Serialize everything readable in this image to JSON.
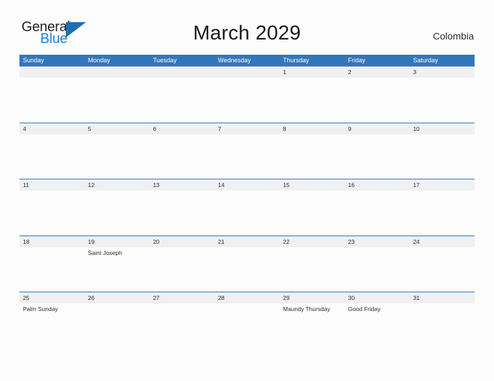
{
  "brand": {
    "name_part1": "General",
    "name_part2": "Blue",
    "flag_icon": "flag-triangle-icon",
    "color_dark": "#231f20",
    "color_blue": "#1b7fd4"
  },
  "header": {
    "title": "March 2029",
    "region": "Colombia"
  },
  "theme": {
    "header_blue": "#3276bc",
    "band_gray": "#f0f0f0",
    "page_background": "#fdfdfd",
    "text": "#2b2b2b"
  },
  "calendar": {
    "weekdays": [
      "Sunday",
      "Monday",
      "Tuesday",
      "Wednesday",
      "Thursday",
      "Friday",
      "Saturday"
    ],
    "weeks": [
      [
        {
          "date": "",
          "events": []
        },
        {
          "date": "",
          "events": []
        },
        {
          "date": "",
          "events": []
        },
        {
          "date": "",
          "events": []
        },
        {
          "date": "1",
          "events": []
        },
        {
          "date": "2",
          "events": []
        },
        {
          "date": "3",
          "events": []
        }
      ],
      [
        {
          "date": "4",
          "events": []
        },
        {
          "date": "5",
          "events": []
        },
        {
          "date": "6",
          "events": []
        },
        {
          "date": "7",
          "events": []
        },
        {
          "date": "8",
          "events": []
        },
        {
          "date": "9",
          "events": []
        },
        {
          "date": "10",
          "events": []
        }
      ],
      [
        {
          "date": "11",
          "events": []
        },
        {
          "date": "12",
          "events": []
        },
        {
          "date": "13",
          "events": []
        },
        {
          "date": "14",
          "events": []
        },
        {
          "date": "15",
          "events": []
        },
        {
          "date": "16",
          "events": []
        },
        {
          "date": "17",
          "events": []
        }
      ],
      [
        {
          "date": "18",
          "events": []
        },
        {
          "date": "19",
          "events": [
            "Saint Joseph"
          ]
        },
        {
          "date": "20",
          "events": []
        },
        {
          "date": "21",
          "events": []
        },
        {
          "date": "22",
          "events": []
        },
        {
          "date": "23",
          "events": []
        },
        {
          "date": "24",
          "events": []
        }
      ],
      [
        {
          "date": "25",
          "events": [
            "Palm Sunday"
          ]
        },
        {
          "date": "26",
          "events": []
        },
        {
          "date": "27",
          "events": []
        },
        {
          "date": "28",
          "events": []
        },
        {
          "date": "29",
          "events": [
            "Maundy Thursday"
          ]
        },
        {
          "date": "30",
          "events": [
            "Good Friday"
          ]
        },
        {
          "date": "31",
          "events": []
        }
      ]
    ]
  }
}
